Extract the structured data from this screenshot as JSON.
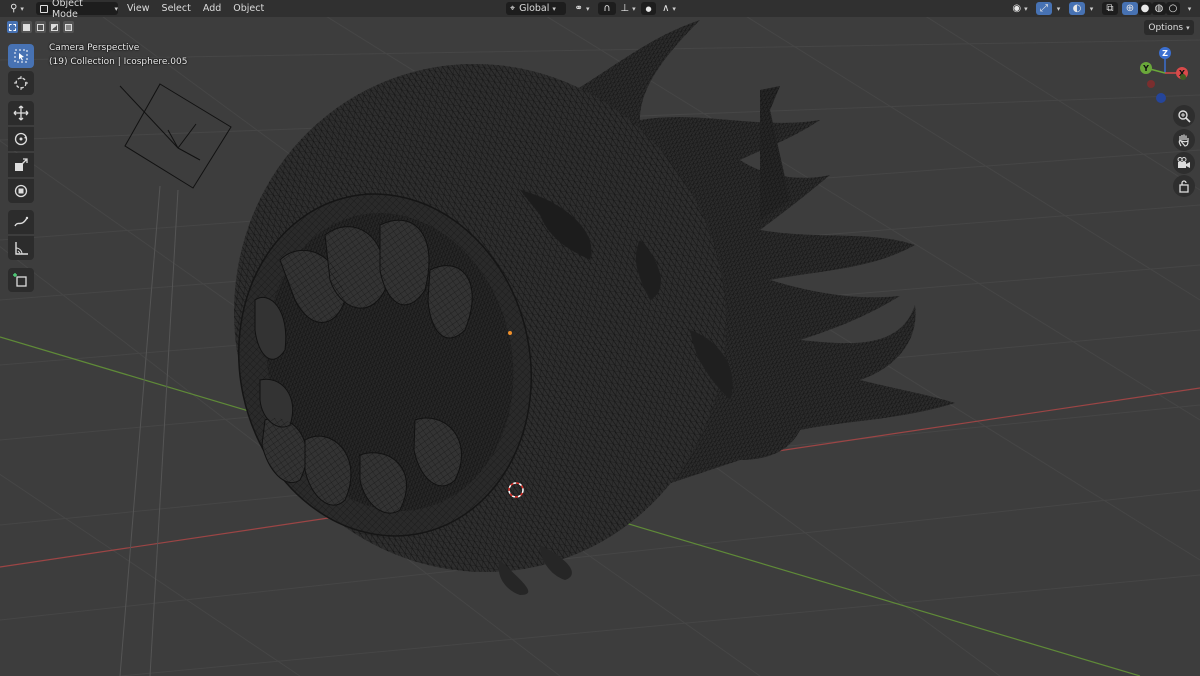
{
  "header": {
    "mode_label": "Object Mode",
    "menus": [
      "View",
      "Select",
      "Add",
      "Object"
    ],
    "orientation_label": "Global"
  },
  "sub": {
    "options_label": "Options"
  },
  "overlay": {
    "view_name": "Camera Perspective",
    "collection_info": "(19) Collection | Icosphere.005"
  },
  "gizmo": {
    "z_label": "Z",
    "y_label": "Y",
    "x_label": "X"
  },
  "tools": [
    "select-box-icon",
    "cursor-icon",
    "move-icon",
    "rotate-icon",
    "scale-icon",
    "transform-icon",
    "annotate-icon",
    "measure-icon",
    "add-cube-icon"
  ],
  "colors": {
    "background": "#3d3d3d",
    "header": "#303030",
    "accent_blue": "#4772b3",
    "x_axis": "#a84848",
    "y_axis": "#6a9a3a",
    "mesh_fill": "#2e2e2e",
    "wire": "#0e0e0e",
    "grid": "#474747"
  }
}
